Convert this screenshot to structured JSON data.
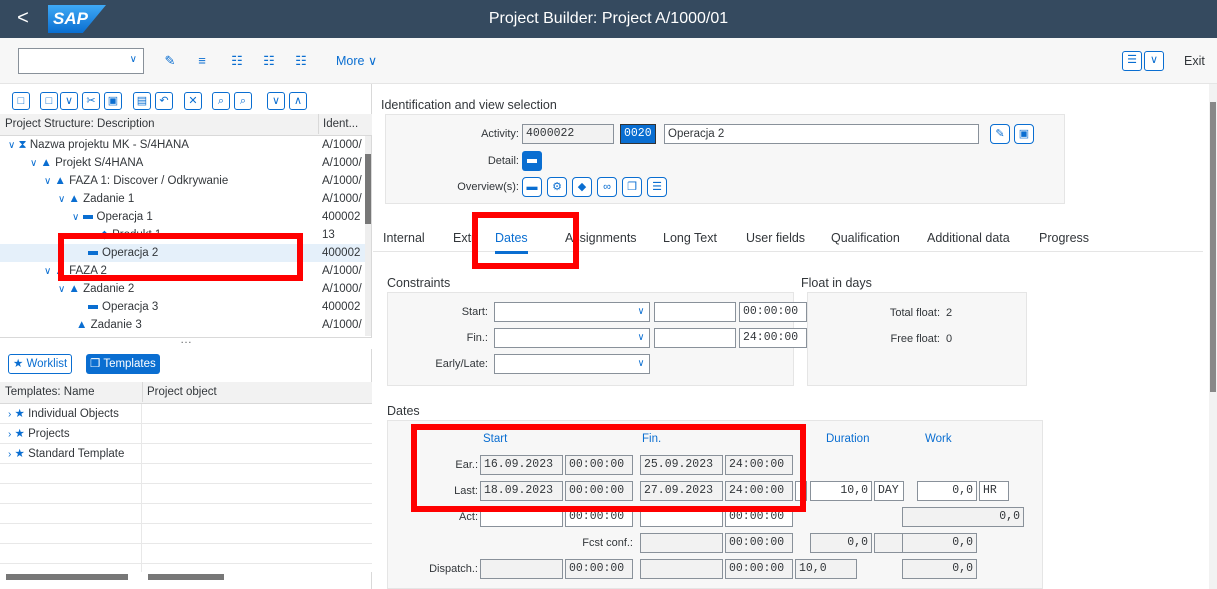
{
  "shell": {
    "back": "<",
    "logo": "SAP",
    "title": "Project Builder: Project A/1000/01"
  },
  "toolbar": {
    "more_label": "More",
    "exit_label": "Exit"
  },
  "structure": {
    "col_desc": "Project Structure: Description",
    "col_ident": "Ident...",
    "rows": [
      {
        "label": "Nazwa projektu MK - S/4HANA",
        "ident": "A/1000/"
      },
      {
        "label": "Projekt S/4HANA",
        "ident": "A/1000/"
      },
      {
        "label": "FAZA 1: Discover / Odkrywanie",
        "ident": "A/1000/"
      },
      {
        "label": "Zadanie 1",
        "ident": "A/1000/"
      },
      {
        "label": "Operacja 1",
        "ident": "400002"
      },
      {
        "label": "Produkt 1",
        "ident": "13"
      },
      {
        "label": "Operacja 2",
        "ident": "400002"
      },
      {
        "label": "FAZA 2",
        "ident": "A/1000/"
      },
      {
        "label": "Zadanie 2",
        "ident": "A/1000/"
      },
      {
        "label": "Operacja 3",
        "ident": "400002"
      },
      {
        "label": "Zadanie 3",
        "ident": "A/1000/"
      }
    ]
  },
  "worklist": {
    "worklist_label": "Worklist",
    "templates_label": "Templates"
  },
  "templates": {
    "col_name": "Templates: Name",
    "col_obj": "Project object",
    "rows": [
      "Individual Objects",
      "Projects",
      "Standard Template"
    ]
  },
  "ident": {
    "section": "Identification and view selection",
    "activity_label": "Activity:",
    "activity_value": "4000022",
    "activity_op": "0020",
    "activity_name": "Operacja 2",
    "detail_label": "Detail:",
    "overview_label": "Overview(s):"
  },
  "tabs": [
    "Internal",
    "Extr",
    "Dates",
    "Assignments",
    "Long Text",
    "User fields",
    "Qualification",
    "Additional data",
    "Progress"
  ],
  "constraints": {
    "section": "Constraints",
    "start_label": "Start:",
    "start_time": "00:00:00",
    "fin_label": "Fin.:",
    "fin_time": "24:00:00",
    "early_label": "Early/Late:"
  },
  "float": {
    "section": "Float in days",
    "total_label": "Total float:",
    "total_value": "2",
    "free_label": "Free float:",
    "free_value": "0"
  },
  "dates": {
    "section": "Dates",
    "col_start": "Start",
    "col_fin": "Fin.",
    "col_duration": "Duration",
    "col_work": "Work",
    "ear_label": "Ear.:",
    "ear_start": "16.09.2023",
    "ear_start_time": "00:00:00",
    "ear_fin": "25.09.2023",
    "ear_fin_time": "24:00:00",
    "last_label": "Last:",
    "last_start": "18.09.2023",
    "last_start_time": "00:00:00",
    "last_fin": "27.09.2023",
    "last_fin_time": "24:00:00",
    "duration": "10,0",
    "duration_unit": "DAY",
    "work": "0,0",
    "work_unit": "HR",
    "act_label": "Act:",
    "act_start_time": "00:00:00",
    "act_fin_time": "00:00:00",
    "act_work": "0,0",
    "fcst_label": "Fcst conf.:",
    "fcst_time": "00:00:00",
    "fcst_dur": "0,0",
    "fcst_work": "0,0",
    "dispatch_label": "Dispatch.:",
    "dispatch_start_time": "00:00:00",
    "dispatch_fin_time": "00:00:00",
    "dispatch_dur": "10,0",
    "dispatch_work": "0,0"
  }
}
